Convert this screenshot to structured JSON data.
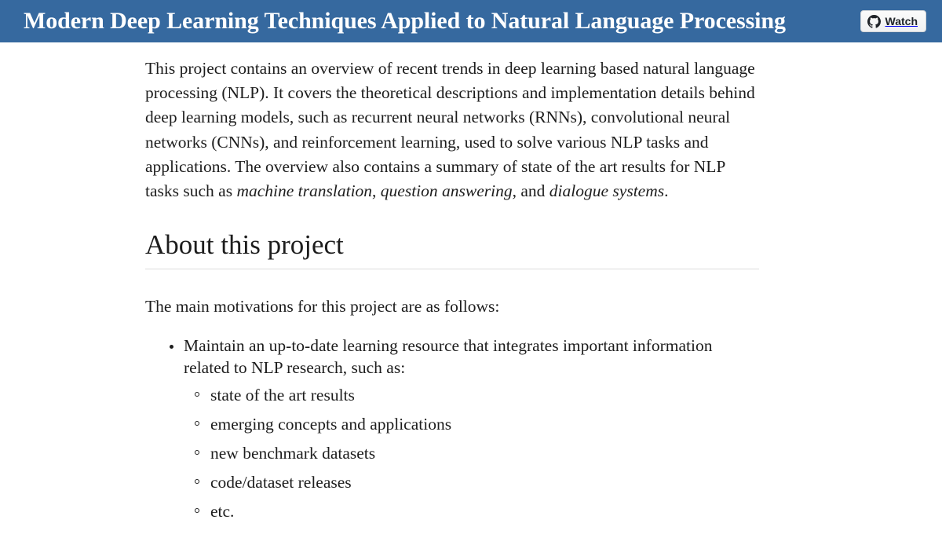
{
  "header": {
    "title": "Modern Deep Learning Techniques Applied to Natural Language Processing",
    "background_color": "#36699f",
    "title_color": "#ffffff",
    "watch_button": {
      "label": "Watch",
      "icon": "github-octocat-icon"
    }
  },
  "main": {
    "intro": {
      "part1": "This project contains an overview of recent trends in deep learning based natural language processing (NLP). It covers the theoretical descriptions and implementation details behind deep learning models, such as recurrent neural networks (RNNs), convolutional neural networks (CNNs), and reinforcement learning, used to solve various NLP tasks and applications. The overview also contains a summary of state of the art results for NLP tasks such as ",
      "em1": "machine translation",
      "part2": ", ",
      "em2": "question answering",
      "part3": ", and ",
      "em3": "dialogue systems",
      "part4": "."
    },
    "section_heading": "About this project",
    "lead": "The main motivations for this project are as follows:",
    "bullets": [
      {
        "text": "Maintain an up-to-date learning resource that integrates important information related to NLP research, such as:",
        "sub_items": [
          "state of the art results",
          "emerging concepts and applications",
          "new benchmark datasets",
          "code/dataset releases",
          "etc."
        ]
      }
    ]
  }
}
